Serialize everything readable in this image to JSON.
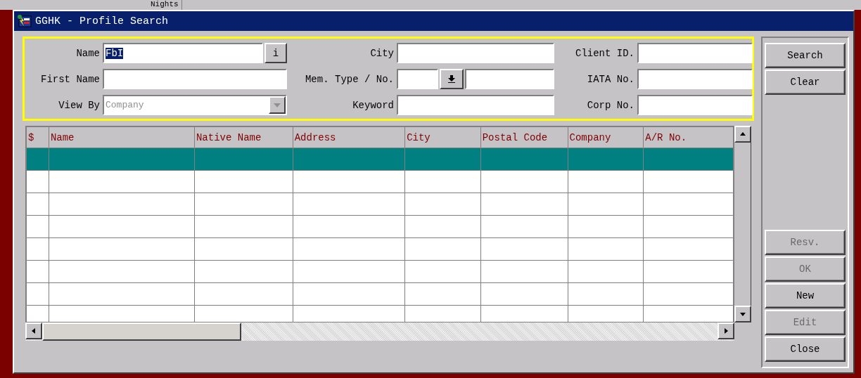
{
  "background_window": {
    "label": "Nights"
  },
  "window": {
    "title": "GGHK - Profile Search"
  },
  "search_form": {
    "name": {
      "label": "Name",
      "value": "FbI",
      "value_selected": true,
      "info_button": "i"
    },
    "first_name": {
      "label": "First Name"
    },
    "view_by": {
      "label": "View By",
      "value": "Company",
      "disabled": true
    },
    "city": {
      "label": "City"
    },
    "mem_type_no": {
      "label": "Mem. Type / No."
    },
    "keyword": {
      "label": "Keyword"
    },
    "client_id": {
      "label": "Client ID."
    },
    "iata_no": {
      "label": "IATA No."
    },
    "corp_no": {
      "label": "Corp No."
    }
  },
  "table": {
    "columns": [
      "$",
      "Name",
      "Native Name",
      "Address",
      "City",
      "Postal Code",
      "Company",
      "A/R No."
    ],
    "rows": [
      {
        "selected": true
      },
      {
        "selected": false
      },
      {
        "selected": false
      },
      {
        "selected": false
      },
      {
        "selected": false
      },
      {
        "selected": false
      },
      {
        "selected": false
      },
      {
        "selected": false
      }
    ]
  },
  "buttons_top": [
    {
      "label": "Search",
      "disabled": false
    },
    {
      "label": "Clear",
      "disabled": false
    }
  ],
  "buttons_bottom": [
    {
      "label": "Resv.",
      "disabled": true
    },
    {
      "label": "OK",
      "disabled": true
    },
    {
      "label": "New",
      "disabled": false
    },
    {
      "label": "Edit",
      "disabled": true
    },
    {
      "label": "Close",
      "disabled": false
    }
  ]
}
